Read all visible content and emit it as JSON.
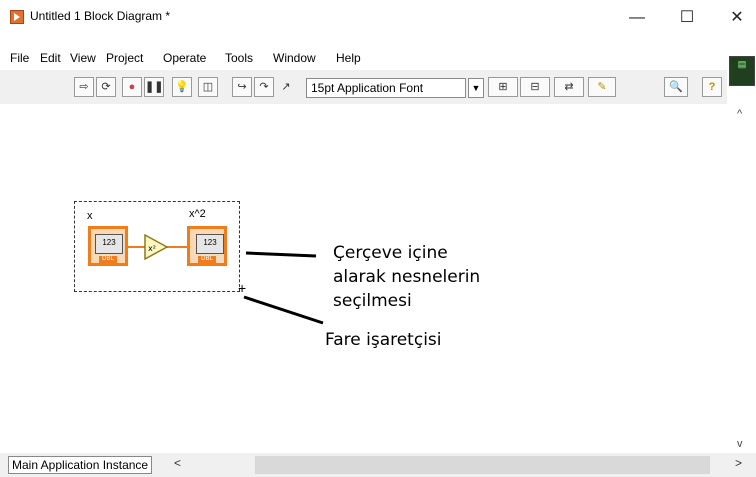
{
  "window": {
    "title": "Untitled 1 Block Diagram *",
    "minimize_symbol": "—",
    "maximize_symbol": "☐",
    "close_symbol": "✕"
  },
  "menu": [
    "File",
    "Edit",
    "View",
    "Project",
    "Operate",
    "Tools",
    "Window",
    "Help"
  ],
  "toolbar": {
    "font": "15pt Application Font",
    "buttons": [
      {
        "icon": "run-arrow-icon",
        "glyph": "⇨"
      },
      {
        "icon": "run-continuously-icon",
        "glyph": "⟳"
      },
      {
        "icon": "abort-icon",
        "glyph": "●"
      },
      {
        "icon": "pause-icon",
        "glyph": "❚❚"
      },
      {
        "icon": "highlight-execution-icon",
        "glyph": "💡"
      },
      {
        "icon": "retain-wire-values-icon",
        "glyph": "◫"
      },
      {
        "icon": "step-into-icon",
        "glyph": "↪"
      },
      {
        "icon": "step-over-icon",
        "glyph": "↷"
      },
      {
        "icon": "step-out-icon",
        "glyph": "↗"
      }
    ],
    "right_buttons": [
      {
        "icon": "align-objects-icon",
        "glyph": "⊞"
      },
      {
        "icon": "distribute-objects-icon",
        "glyph": "⊟"
      },
      {
        "icon": "reorder-icon",
        "glyph": "⇄"
      },
      {
        "icon": "cleanup-diagram-icon",
        "glyph": "✎"
      },
      {
        "icon": "search-icon",
        "glyph": "🔍"
      },
      {
        "icon": "help-icon",
        "glyph": "?"
      }
    ]
  },
  "diagram": {
    "x_label": "x",
    "y_label": "x^2",
    "x_value": "123",
    "y_value": "123",
    "dbl_tag": "DBL",
    "function_label": "x²"
  },
  "annotations": {
    "selection_text": "Çerçeve içine alarak nesnelerin seçilmesi",
    "pointer_text": "Fare işaretçisi"
  },
  "status": {
    "instance": "Main Application Instance",
    "scroll_left": "<",
    "scroll_right": ">",
    "scroll_up": "^",
    "scroll_down": "v"
  },
  "colors": {
    "terminal_orange": "#f07d1d",
    "toolbar_bg": "#f0f0f0"
  }
}
